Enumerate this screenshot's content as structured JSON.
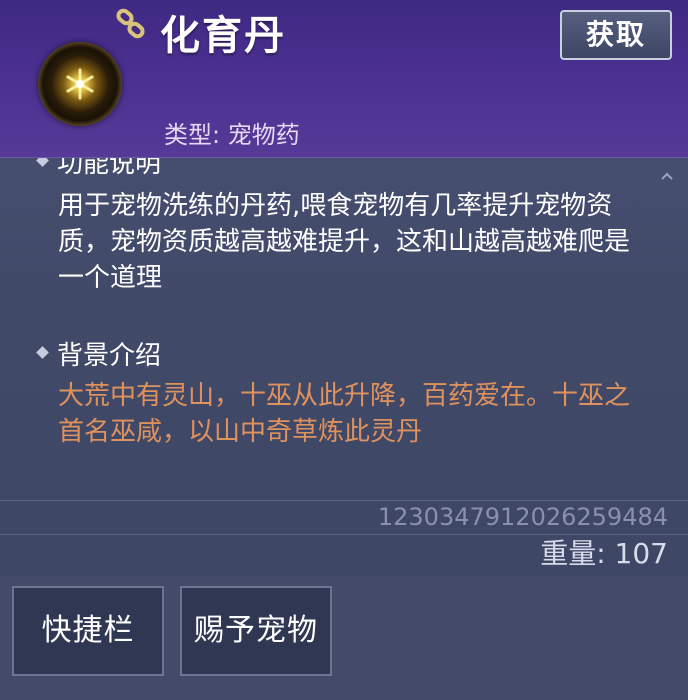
{
  "item": {
    "name": "化育丹",
    "type_label": "类型: 宠物药",
    "icon": "glowing-orb-icon",
    "link_icon": "chain-link-icon"
  },
  "header": {
    "get_label": "获取"
  },
  "sections": {
    "function": {
      "title": "功能说明",
      "text": "用于宠物洗练的丹药,喂食宠物有几率提升宠物资质，宠物资质越高越难提升，这和山越高越难爬是一个道理"
    },
    "background": {
      "title": "背景介绍",
      "text": "大荒中有灵山，十巫从此升降，百药爱在。十巫之首名巫咸，以山中奇草炼此灵丹"
    }
  },
  "meta": {
    "serial": "1230347912026259484",
    "weight": "重量: 107"
  },
  "actions": {
    "shortcut_label": "快捷栏",
    "give_pet_label": "赐予宠物"
  },
  "colors": {
    "header_purple": "#4a2f90",
    "body_blue": "#424a6a",
    "background_text": "#e0925c"
  }
}
